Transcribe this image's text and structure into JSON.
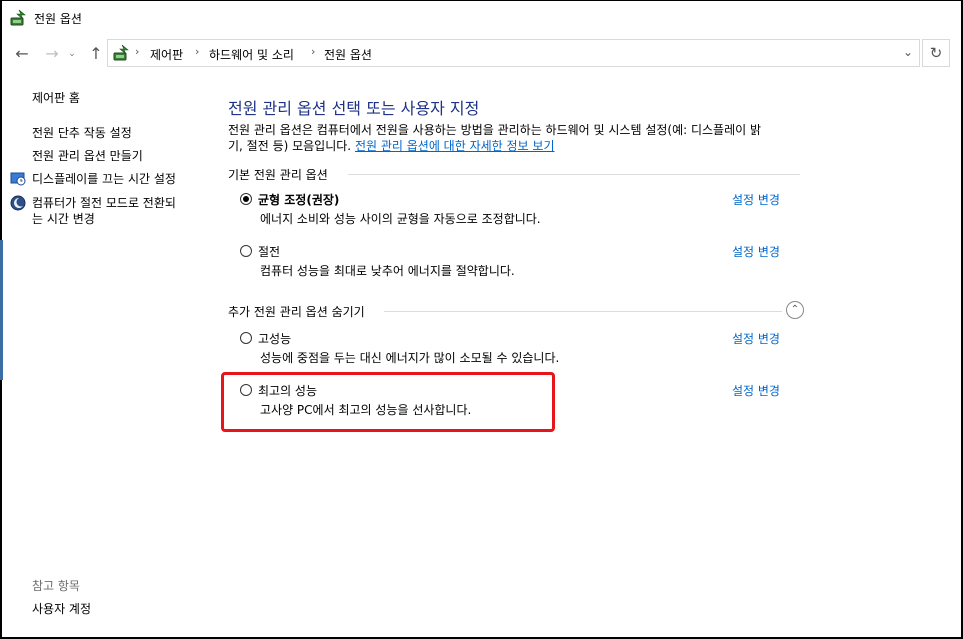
{
  "window": {
    "title": "전원 옵션"
  },
  "nav": {
    "back_icon": "back-arrow-icon",
    "forward_icon": "forward-arrow-icon",
    "recent_icon": "chevron-down-icon",
    "up_icon": "up-arrow-icon",
    "breadcrumb": [
      "제어판",
      "하드웨어 및 소리",
      "전원 옵션"
    ],
    "refresh_icon": "refresh-icon"
  },
  "sidebar": {
    "home": "제어판 홈",
    "links": [
      "전원 단추 작동 설정",
      "전원 관리 옵션 만들기",
      "디스플레이를 끄는 시간 설정",
      "컴퓨터가 절전 모드로 전환되는 시간 변경"
    ],
    "link3_line1": "컴퓨터가 절전 모드로 전환되",
    "link3_line2": "는 시간 변경",
    "see_also": "참고 항목",
    "user_accounts": "사용자 계정"
  },
  "main": {
    "title": "전원 관리 옵션 선택 또는 사용자 지정",
    "desc_line1": "전원 관리 옵션은 컴퓨터에서 전원을 사용하는 방법을 관리하는 하드웨어 및 시스템 설정(예: 디스플레이 밝",
    "desc_line2": "기, 절전 등) 모음입니다.",
    "desc_link": "전원 관리 옵션에 대한 자세한 정보 보기",
    "preferred_header": "기본 전원 관리 옵션",
    "hidden_header": "추가 전원 관리 옵션 숨기기",
    "change_label": "설정 변경",
    "plans": [
      {
        "name": "균형 조정(권장)",
        "desc": "에너지 소비와 성능 사이의 균형을 자동으로 조정합니다.",
        "selected": true
      },
      {
        "name": "절전",
        "desc": "컴퓨터 성능을 최대로 낮추어 에너지를 절약합니다.",
        "selected": false
      },
      {
        "name": "고성능",
        "desc": "성능에 중점을 두는 대신 에너지가 많이 소모될 수 있습니다.",
        "selected": false
      },
      {
        "name": "최고의 성능",
        "desc": "고사양 PC에서 최고의 성능을 선사합니다.",
        "selected": false
      }
    ]
  },
  "colors": {
    "title": "#1e3287",
    "link": "#0066cc",
    "highlight": "#e8141b"
  }
}
